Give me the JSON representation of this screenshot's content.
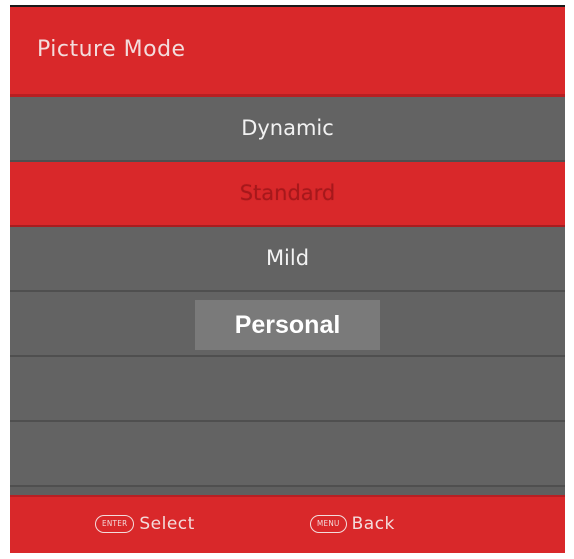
{
  "header": {
    "title": "Picture Mode"
  },
  "menu": {
    "items": [
      {
        "label": "Dynamic",
        "state": "normal"
      },
      {
        "label": "Standard",
        "state": "selected"
      },
      {
        "label": "Mild",
        "state": "normal"
      },
      {
        "label": "Personal",
        "state": "focused"
      },
      {
        "label": "",
        "state": "empty"
      },
      {
        "label": "",
        "state": "empty"
      }
    ]
  },
  "footer": {
    "select_key": "ENTER",
    "select_label": "Select",
    "back_key": "MENU",
    "back_label": "Back"
  },
  "colors": {
    "accent": "#d9282a",
    "row_bg": "#636363",
    "focus_bg": "#7a7a7a"
  }
}
